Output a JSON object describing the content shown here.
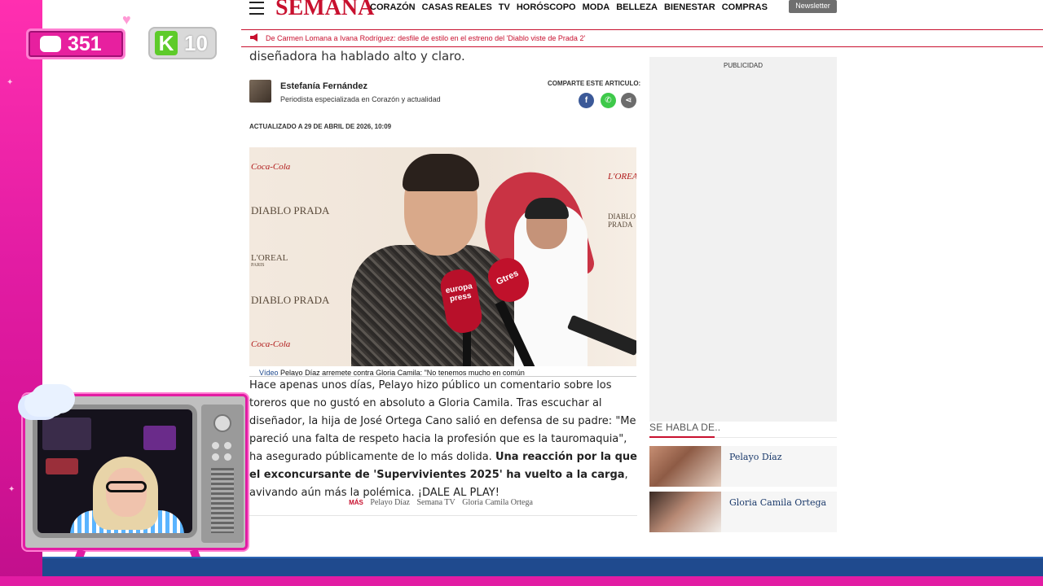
{
  "overlay": {
    "message_count": "351",
    "k_count": "10",
    "colors": {
      "frame_pink": "#e21ca3",
      "bottom_bar_blue": "#1f4a8e"
    }
  },
  "header": {
    "logo": "SEMANA",
    "nav": [
      "CORAZÓN",
      "CASAS REALES",
      "TV",
      "HORÓSCOPO",
      "MODA",
      "BELLEZA",
      "BIENESTAR",
      "COMPRAS"
    ],
    "newsletter": "Newsletter",
    "ticker": "De Carmen Lomana a Ivana Rodríguez: desfile de estilo en el estreno del 'Diablo viste de Prada 2'"
  },
  "article": {
    "lead_end": "diseñadora ha hablado alto y claro.",
    "author_name": "Estefanía Fernández",
    "author_role": "Periodista especializada en Corazón y actualidad",
    "share_label": "COMPARTE ESTE ARTICULO:",
    "updated": "ACTUALIZADO A 29 DE ABRIL DE 2026, 10:09",
    "video": {
      "caption_prefix": "Vídeo",
      "caption": "Pelayo Díaz arremete contra Gloria Camila: \"No tenemos mucho en común",
      "mic1": "europa press",
      "mic2": "Gtres",
      "brand_top": "Coca-Cola",
      "brand_diablo": "DIABLO PRADA",
      "brand_loreal": "L'OREAL",
      "brand_paris": "PARIS"
    },
    "body_p1": "Hace apenas unos días, Pelayo hizo público un comentario sobre los toreros que no gustó en absoluto a Gloria Camila. Tras escuchar al diseñador, la hija de José Ortega Cano salió en defensa de su padre: \"Me pareció una falta de respeto hacia la profesión que es la tauromaquia\", ha asegurado públicamente de lo más dolida.",
    "body_bold": "Una reacción por la que el exconcursante de 'Supervivientes 2025' ha vuelto a la carga",
    "body_end": ", avivando aún más la polémica. ¡DALE AL PLAY!",
    "more_label": "MÁS",
    "tags": [
      "Pelayo Díaz",
      "Semana TV",
      "Gloria Camila Ortega"
    ]
  },
  "sidebar": {
    "ad_label": "PUBLICIDAD",
    "section_title": "SE HABLA DE..",
    "related": [
      {
        "name": "Pelayo Díaz"
      },
      {
        "name": "Gloria Camila Ortega"
      }
    ]
  }
}
